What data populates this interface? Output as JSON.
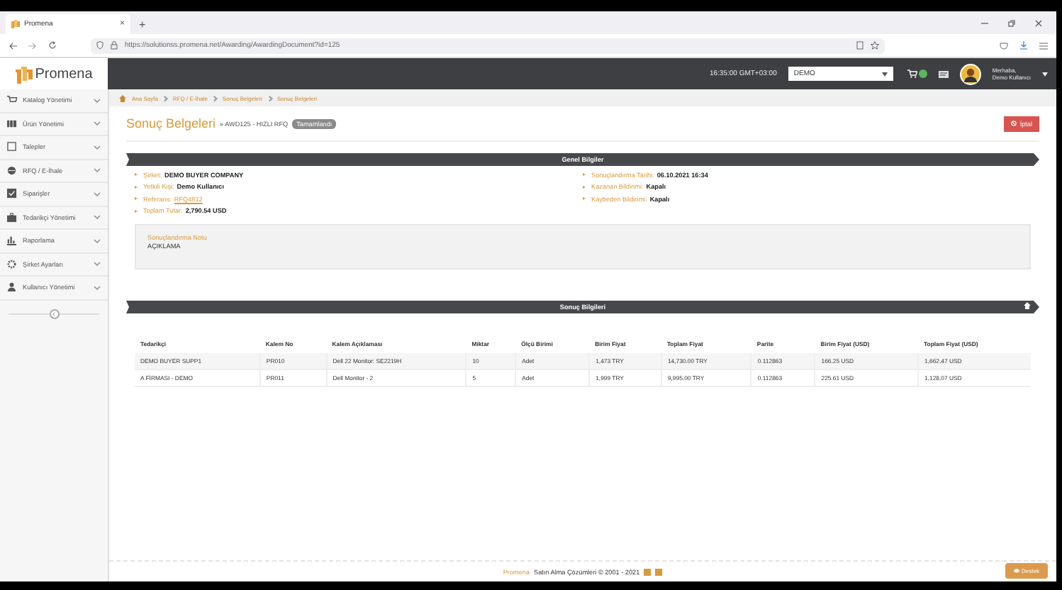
{
  "browser": {
    "tab_title": "Promena",
    "tab_close": "×",
    "new_tab": "+",
    "url": "https://solutionss.promena.net/Awarding/AwardingDocument?id=125"
  },
  "header": {
    "logo": "Promena",
    "time": "16:35:00 GMT+03:00",
    "company_select": "DEMO",
    "greeting": "Merhaba,",
    "user": "Demo Kullanıcı"
  },
  "sidebar": {
    "items": [
      {
        "label": "Katalog Yönetimi"
      },
      {
        "label": "Ürün Yönetimi"
      },
      {
        "label": "Talepler"
      },
      {
        "label": "RFQ / E-İhale"
      },
      {
        "label": "Siparişler"
      },
      {
        "label": "Tedarikçi Yönetimi"
      },
      {
        "label": "Raporlama"
      },
      {
        "label": "Şirket Ayarları"
      },
      {
        "label": "Kullanıcı Yönetimi"
      }
    ]
  },
  "breadcrumb": [
    "Ana Sayfa",
    "RFQ / E-İhale",
    "Sonuç Belgeleri",
    "Sonuç Belgeleri"
  ],
  "page": {
    "title": "Sonuç Belgeleri",
    "subtitle": "» AWD125 - HIZLI RFQ",
    "status": "Tamamlandı",
    "cancel_button": "İptal"
  },
  "general_info": {
    "title": "Genel Bilgiler",
    "left": [
      {
        "label": "Şirket:",
        "value": "DEMO BUYER COMPANY",
        "kind": "text"
      },
      {
        "label": "Yetkili Kişi:",
        "value": "Demo Kullanıcı",
        "kind": "text"
      },
      {
        "label": "Referans:",
        "value": "RFQ4812",
        "kind": "link"
      },
      {
        "label": "Toplam Tutar:",
        "value": "2,790.54 USD",
        "kind": "text"
      }
    ],
    "right": [
      {
        "label": "Sonuçlandırma Tarihi:",
        "value": "06.10.2021 16:34",
        "kind": "text"
      },
      {
        "label": "Kazanan Bildirimi:",
        "value": "Kapalı",
        "kind": "text"
      },
      {
        "label": "Kaybeden Bildirimi:",
        "value": "Kapalı",
        "kind": "text"
      }
    ],
    "note": {
      "label": "Sonuçlandırma Notu",
      "text": "AÇIKLAMA"
    }
  },
  "results": {
    "title": "Sonuç Bilgileri",
    "table": {
      "columns": [
        "Tedarikçi",
        "Kalem No",
        "Kalem Açıklaması",
        "Miktar",
        "Ölçü Birimi",
        "Birim Fiyat",
        "Toplam Fiyat",
        "Parite",
        "Birim Fiyat (USD)",
        "Toplam Fiyat (USD)"
      ],
      "rows": [
        [
          "DEMO BUYER SUPP1",
          "PR010",
          "Dell 22 Monitor: SE2219H",
          "10",
          "Adet",
          "1,473 TRY",
          "14,730.00 TRY",
          "0.112863",
          "166.25 USD",
          "1,662.47 USD"
        ],
        [
          "A FİRMASI - DEMO",
          "PR011",
          "Dell Monitor - 2",
          "5",
          "Adet",
          "1,999 TRY",
          "9,995.00 TRY",
          "0.112863",
          "225.61 USD",
          "1,128.07 USD"
        ]
      ]
    }
  },
  "footer": {
    "brand": "Promena",
    "text": "Satın Alma Çözümleri © 2001 - 2021",
    "support_button": "Destek"
  }
}
